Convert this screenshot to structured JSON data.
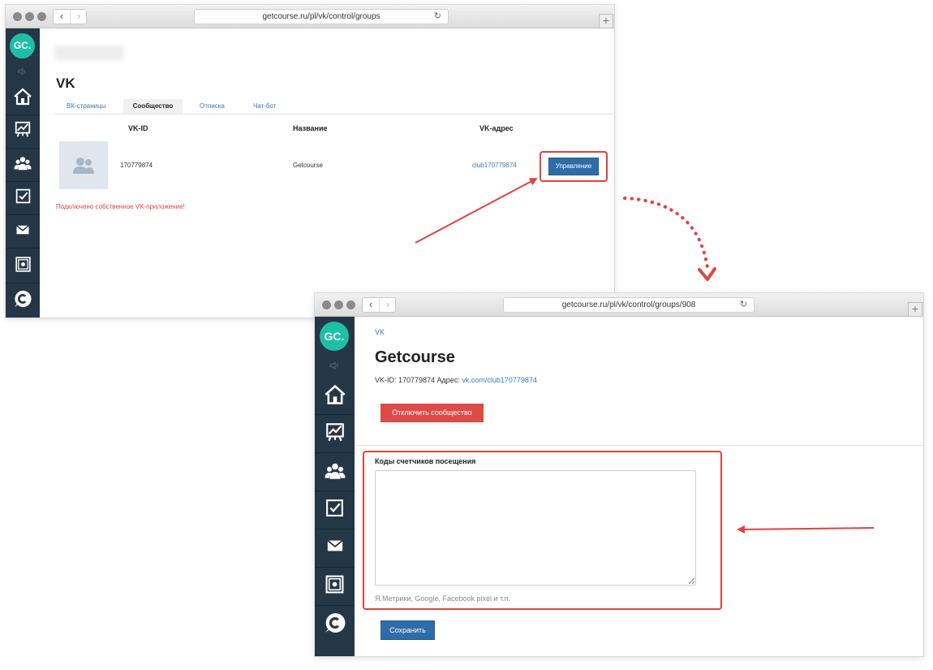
{
  "window1": {
    "url": "getcourse.ru/pl/vk/control/groups",
    "page_title": "VK",
    "tabs": [
      {
        "label": "ВК-страницы"
      },
      {
        "label": "Сообщество"
      },
      {
        "label": "Отписка"
      },
      {
        "label": "Чат-бот"
      }
    ],
    "table": {
      "headers": {
        "vkid": "VK-ID",
        "name": "Название",
        "address": "VK-адрес"
      },
      "row": {
        "vkid": "170779874",
        "name": "Getcourse",
        "address": "club170779874",
        "action": "Управление"
      }
    },
    "warning": "Подключено собственное VK-приложение!"
  },
  "window2": {
    "url": "getcourse.ru/pl/vk/control/groups/908",
    "breadcrumb": "VK",
    "title": "Getcourse",
    "info_prefix": "VK-ID: 170779874 Адрес:",
    "info_link": "vk.com/club170779874",
    "disconnect_label": "Отключить сообщество",
    "counters_label": "Коды счетчиков посещения",
    "counters_value": "",
    "counters_hint": "Я.Метрики, Google, Facebook pixel и т.п.",
    "save_label": "Сохранить"
  },
  "sidebar": {
    "logo": "GC.",
    "icons": [
      "megaphone-icon",
      "home-icon",
      "chart-icon",
      "users-icon",
      "tasks-icon",
      "mail-icon",
      "safe-icon",
      "chat-icon"
    ]
  },
  "colors": {
    "sidebar": "#253747",
    "logo": "#1ebfa7",
    "primary_button": "#2e6da8",
    "danger_button": "#dd4a48",
    "annotation": "#e04341",
    "link": "#3a76b6"
  }
}
